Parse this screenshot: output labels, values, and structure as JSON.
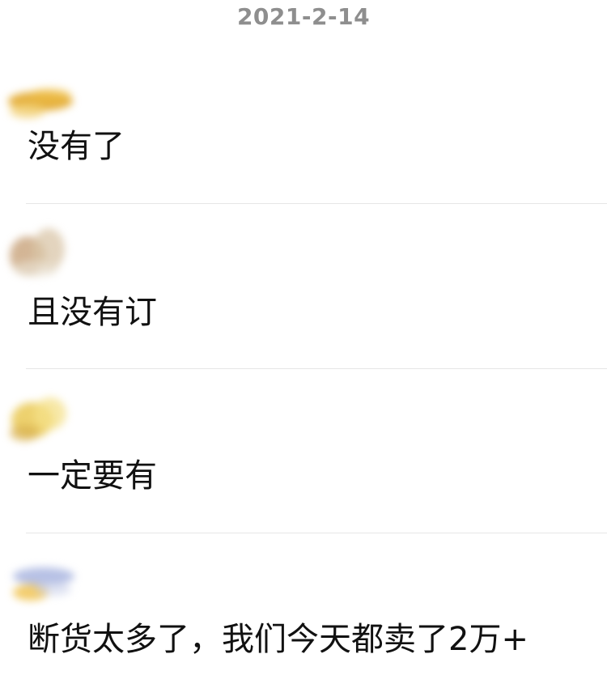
{
  "date": "2021-2-14",
  "comments": [
    {
      "text": "没有了",
      "avatar_colors": [
        "#e0a21c",
        "#f3d27a",
        "#f0c046"
      ]
    },
    {
      "text": "且没有订",
      "avatar_colors": [
        "#c8a27a",
        "#d9c5a8",
        "#e8e0d0"
      ]
    },
    {
      "text": "一定要有",
      "avatar_colors": [
        "#e8c54a",
        "#f4e08a",
        "#d8b050"
      ]
    },
    {
      "text": "断货太多了，我们今天都卖了2万+",
      "avatar_colors": [
        "#aab6e0",
        "#f0c04a",
        "#c9d0ea"
      ]
    }
  ]
}
